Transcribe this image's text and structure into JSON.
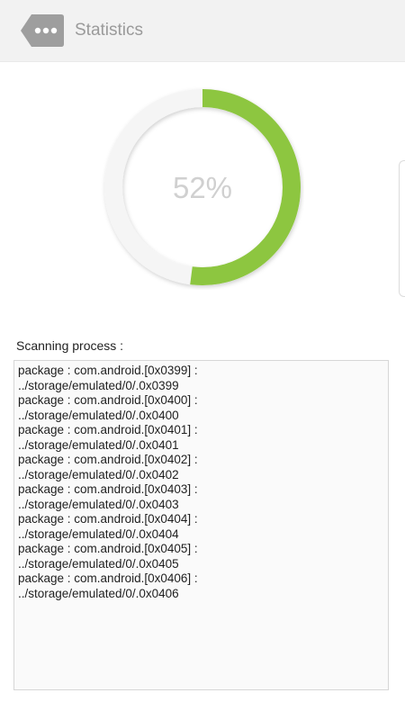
{
  "header": {
    "title": "Statistics",
    "back_icon": "more-dots-back-icon"
  },
  "progress": {
    "value": 52,
    "label": "52%",
    "color": "#8dc63f",
    "track_color": "#f5f5f5"
  },
  "scan": {
    "label": "Scanning process :",
    "lines": [
      "package : com.android.[0x0399] :",
      "../storage/emulated/0/.0x0399",
      "package : com.android.[0x0400] :",
      "../storage/emulated/0/.0x0400",
      "package : com.android.[0x0401] :",
      "../storage/emulated/0/.0x0401",
      "package : com.android.[0x0402] :",
      "../storage/emulated/0/.0x0402",
      "package : com.android.[0x0403] :",
      "../storage/emulated/0/.0x0403",
      "package : com.android.[0x0404] :",
      "../storage/emulated/0/.0x0404",
      "package : com.android.[0x0405] :",
      "../storage/emulated/0/.0x0405",
      "package : com.android.[0x0406] :",
      "../storage/emulated/0/.0x0406"
    ]
  }
}
